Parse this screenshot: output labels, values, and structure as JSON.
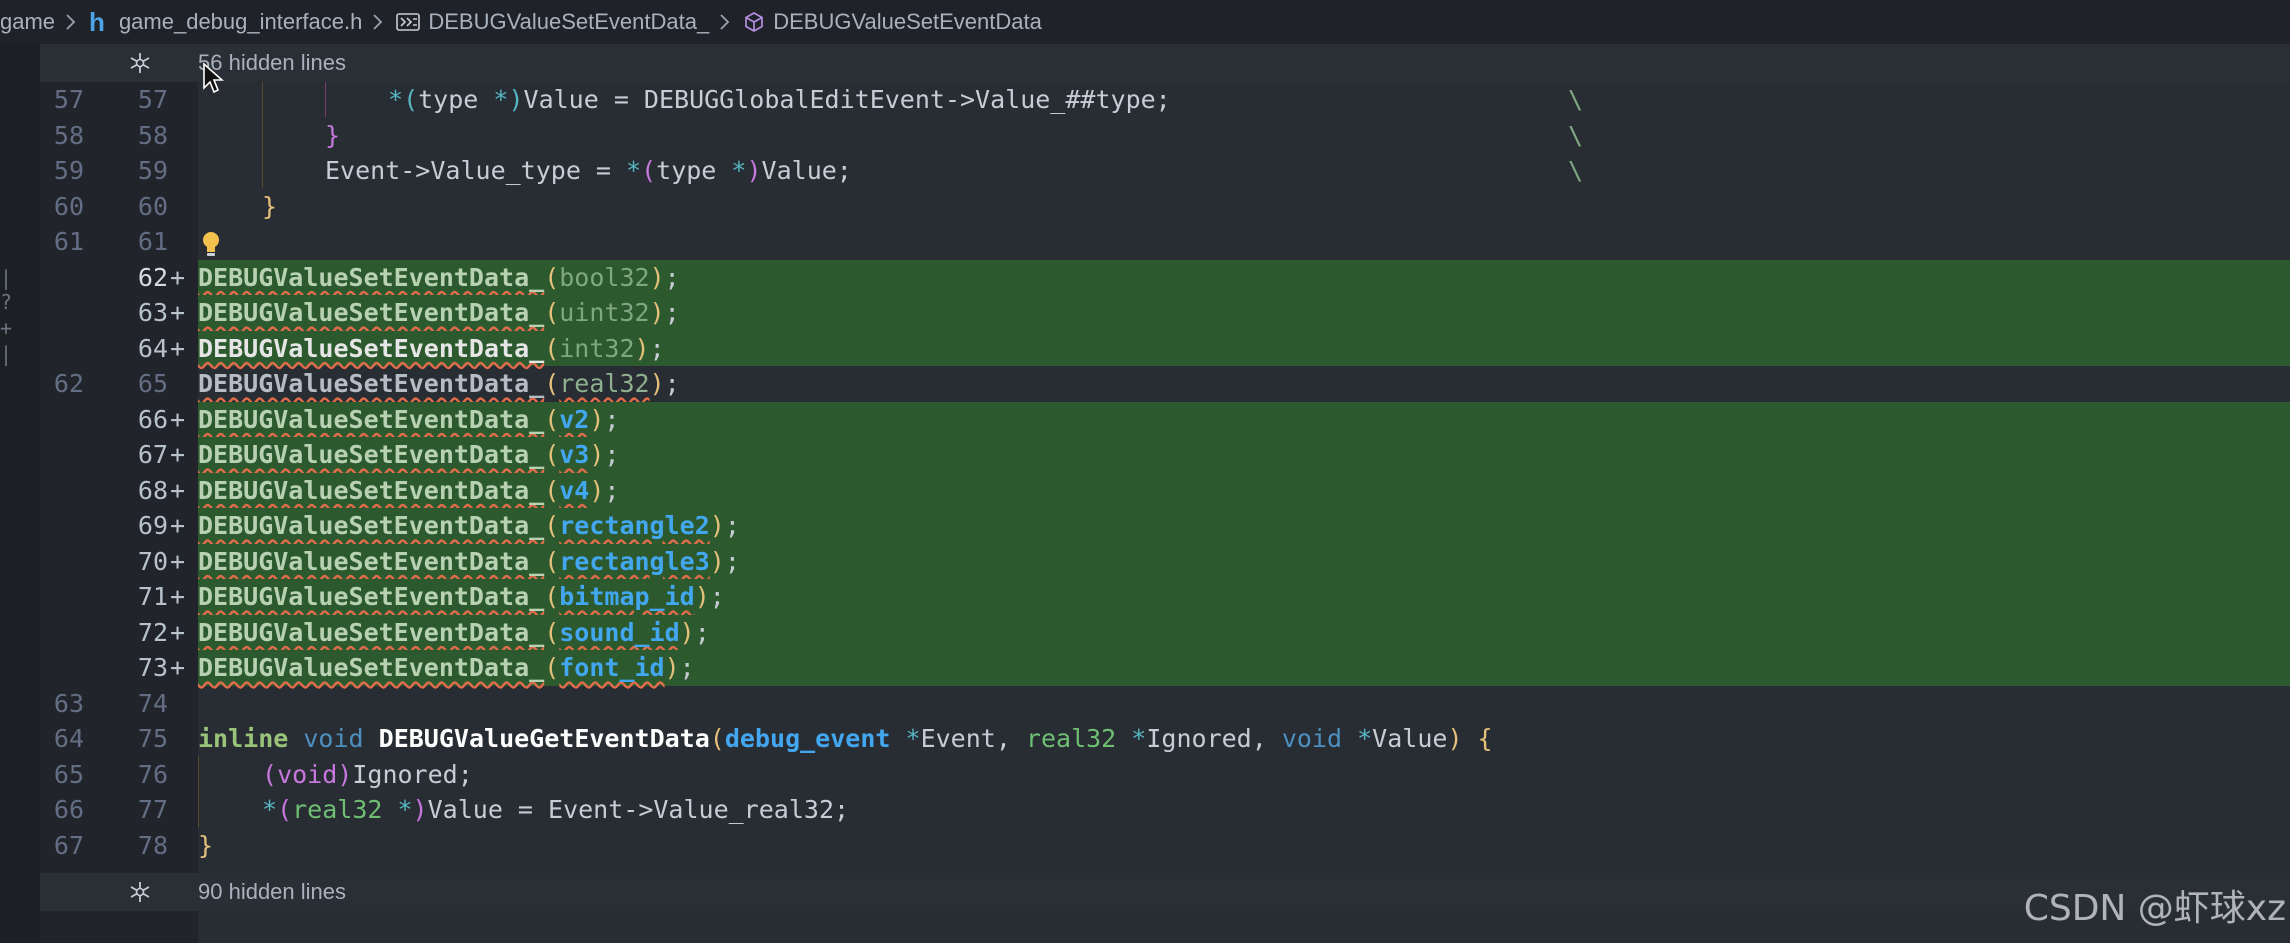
{
  "breadcrumb": {
    "items": [
      {
        "label": "game",
        "icon": "none"
      },
      {
        "label": "game_debug_interface.h",
        "icon": "h-file-icon",
        "icon_text": "h"
      },
      {
        "label": "DEBUGValueSetEventData_",
        "icon": "macro-icon"
      },
      {
        "label": "DEBUGValueSetEventData",
        "icon": "function-cube-icon"
      }
    ]
  },
  "folds": {
    "top": "56 hidden lines",
    "bottom": "90 hidden lines"
  },
  "lines": [
    {
      "old": "57",
      "new": "57",
      "plus": ""
    },
    {
      "old": "58",
      "new": "58",
      "plus": ""
    },
    {
      "old": "59",
      "new": "59",
      "plus": ""
    },
    {
      "old": "60",
      "new": "60",
      "plus": ""
    },
    {
      "old": "61",
      "new": "61",
      "plus": ""
    },
    {
      "old": "",
      "new": "62",
      "plus": "+"
    },
    {
      "old": "",
      "new": "63",
      "plus": "+"
    },
    {
      "old": "",
      "new": "64",
      "plus": "+"
    },
    {
      "old": "62",
      "new": "65",
      "plus": ""
    },
    {
      "old": "",
      "new": "66",
      "plus": "+"
    },
    {
      "old": "",
      "new": "67",
      "plus": "+"
    },
    {
      "old": "",
      "new": "68",
      "plus": "+"
    },
    {
      "old": "",
      "new": "69",
      "plus": "+"
    },
    {
      "old": "",
      "new": "70",
      "plus": "+"
    },
    {
      "old": "",
      "new": "71",
      "plus": "+"
    },
    {
      "old": "",
      "new": "72",
      "plus": "+"
    },
    {
      "old": "",
      "new": "73",
      "plus": "+"
    },
    {
      "old": "63",
      "new": "74",
      "plus": ""
    },
    {
      "old": "64",
      "new": "75",
      "plus": ""
    },
    {
      "old": "65",
      "new": "76",
      "plus": ""
    },
    {
      "old": "66",
      "new": "77",
      "plus": ""
    },
    {
      "old": "67",
      "new": "78",
      "plus": ""
    }
  ],
  "code": {
    "l57": {
      "a": "*",
      "b": "(",
      "c": "type ",
      "d": "*",
      "e": ")",
      "f": "Value = DEBUGGlobalEditEvent->Value_##type;",
      "bs": "\\"
    },
    "l58": {
      "brace": "}",
      "bs": "\\"
    },
    "l59": {
      "a": "Event->Value_type = ",
      "b": "*",
      "c": "(",
      "d": "type ",
      "e": "*",
      "f": ")",
      "g": "Value;",
      "bs": "\\"
    },
    "l60": {
      "brace": "}"
    },
    "macro": "DEBUGValueSetEventData_",
    "open": "(",
    "close": ")",
    "semi": ";",
    "args": [
      "bool32",
      "uint32",
      "int32",
      "real32",
      "v2",
      "v3",
      "v4",
      "rectangle2",
      "rectangle3",
      "bitmap_id",
      "sound_id",
      "font_id"
    ],
    "l75": {
      "inline": "inline",
      "void1": "void",
      "fn": "DEBUGValueGetEventData",
      "open": "(",
      "t1": "debug_event",
      "s1": " ",
      "star1": "*",
      "p1": "Event, ",
      "t2": "real32",
      "s2": " ",
      "star2": "*",
      "p2": "Ignored, ",
      "void2": "void",
      "s3": " ",
      "star3": "*",
      "p3": "Value",
      "close": ")",
      "brace": " {"
    },
    "l76": {
      "a": "(",
      "b": "void",
      "c": ")",
      "d": "Ignored;"
    },
    "l77": {
      "a": "*",
      "b": "(",
      "c": "real32 ",
      "d": "*",
      "e": ")",
      "f": "Value = Event->Value_real32;"
    },
    "l78": {
      "brace": "}"
    }
  },
  "watermark": "CSDN @虾球xz"
}
